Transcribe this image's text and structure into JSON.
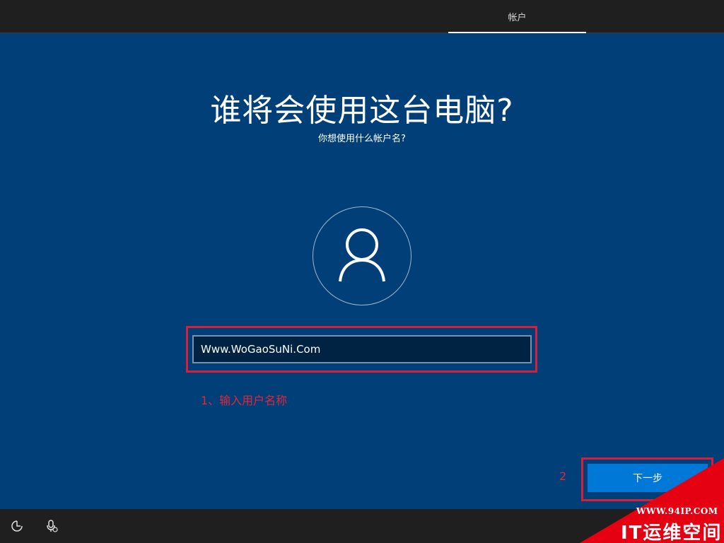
{
  "header": {
    "tab_label": "帐户"
  },
  "page": {
    "title": "谁将会使用这台电脑?",
    "subtitle": "你想使用什么帐户名?"
  },
  "form": {
    "username_value": "Www.WoGaoSuNi.Com"
  },
  "annotations": {
    "step1": "1、输入用户名称",
    "step2": "2"
  },
  "buttons": {
    "next_label": "下一步"
  },
  "footer": {
    "icons": [
      "ease-of-access-icon",
      "microphone-icon"
    ]
  },
  "watermark": {
    "url": "WWW.94IP.COM",
    "brand": "IT运维空间"
  },
  "colors": {
    "background": "#003f78",
    "accent": "#0078d7",
    "annotation": "#d6203a",
    "bar": "#1f1f1f"
  }
}
